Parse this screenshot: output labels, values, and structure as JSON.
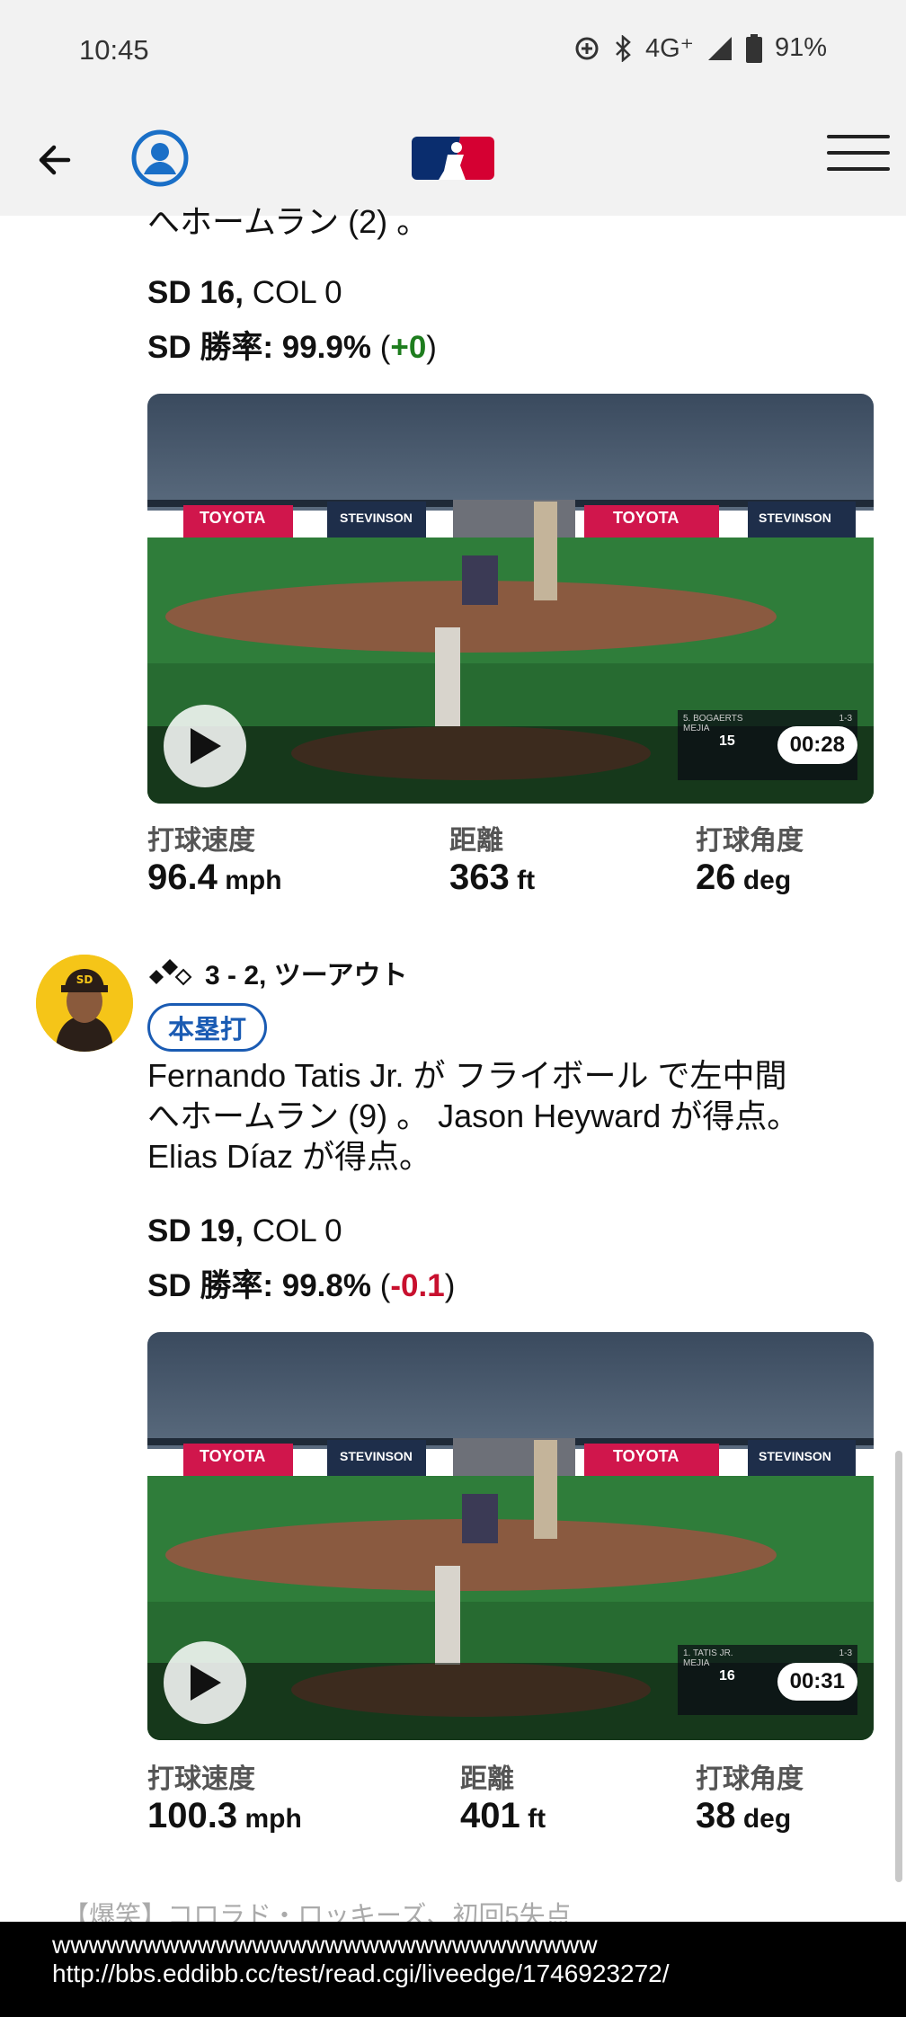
{
  "status_bar": {
    "time": "10:45",
    "network": "4G⁺",
    "battery": "91%",
    "icons": [
      "data-saver-icon",
      "bluetooth-icon",
      "signal-icon",
      "battery-icon"
    ]
  },
  "header": {
    "back_icon": "back-arrow-icon",
    "profile_icon": "account-circle-icon",
    "logo": "mlb-logo",
    "menu_icon": "hamburger-menu-icon",
    "accent": "#1a5bb3"
  },
  "play1": {
    "partial_text": "へホームラン (2) 。",
    "score_team1": "SD 16,",
    "score_team2": " COL 0",
    "wp_team": "SD",
    "wp_label": " 勝率: ",
    "wp_value": "99.9%",
    "wp_open": " (",
    "wp_change": "+0",
    "wp_close": ")",
    "video_duration": "00:28",
    "scorebug_batter": "5. BOGAERTS",
    "scorebug_pitcher": "MEJIA",
    "scorebug_count": "1-3",
    "scorebug_runs": "15",
    "exit_velo_label": "打球速度",
    "exit_velo_value": "96.4",
    "exit_velo_unit": " mph",
    "distance_label": "距離",
    "distance_value": "363",
    "distance_unit": " ft",
    "launch_label": "打球角度",
    "launch_value": "26",
    "launch_unit": " deg"
  },
  "play2": {
    "count": "3 - 2, ツーアウト",
    "result_badge": "本塁打",
    "description_line1": "Fernando Tatis Jr. が フライボール で左中間",
    "description_line2": "へホームラン (9) 。 Jason Heyward が得点。",
    "description_line3": "Elias Díaz が得点。",
    "score_team1": "SD 19,",
    "score_team2": " COL 0",
    "wp_team": "SD",
    "wp_label": " 勝率: ",
    "wp_value": "99.8%",
    "wp_open": " (",
    "wp_change": "-0.1",
    "wp_close": ")",
    "video_duration": "00:31",
    "scorebug_batter": "1. TATIS JR.",
    "scorebug_pitcher": "MEJIA",
    "scorebug_count": "1-3",
    "scorebug_runs": "16",
    "exit_velo_label": "打球速度",
    "exit_velo_value": "100.3",
    "exit_velo_unit": " mph",
    "distance_label": "距離",
    "distance_value": "401",
    "distance_unit": " ft",
    "launch_label": "打球角度",
    "launch_value": "38",
    "launch_unit": " deg"
  },
  "video_ads": {
    "toyota": "TOYOTA",
    "stevinson": "STEVINSON"
  },
  "overlay": {
    "comment": "【爆笑】コロラド・ロッキーズ、初回5失点",
    "line1": "wwwwwwwwwwwwwwwwwwwwwwwwwwwwww",
    "line2": "http://bbs.eddibb.cc/test/read.cgi/liveedge/1746923272/"
  }
}
